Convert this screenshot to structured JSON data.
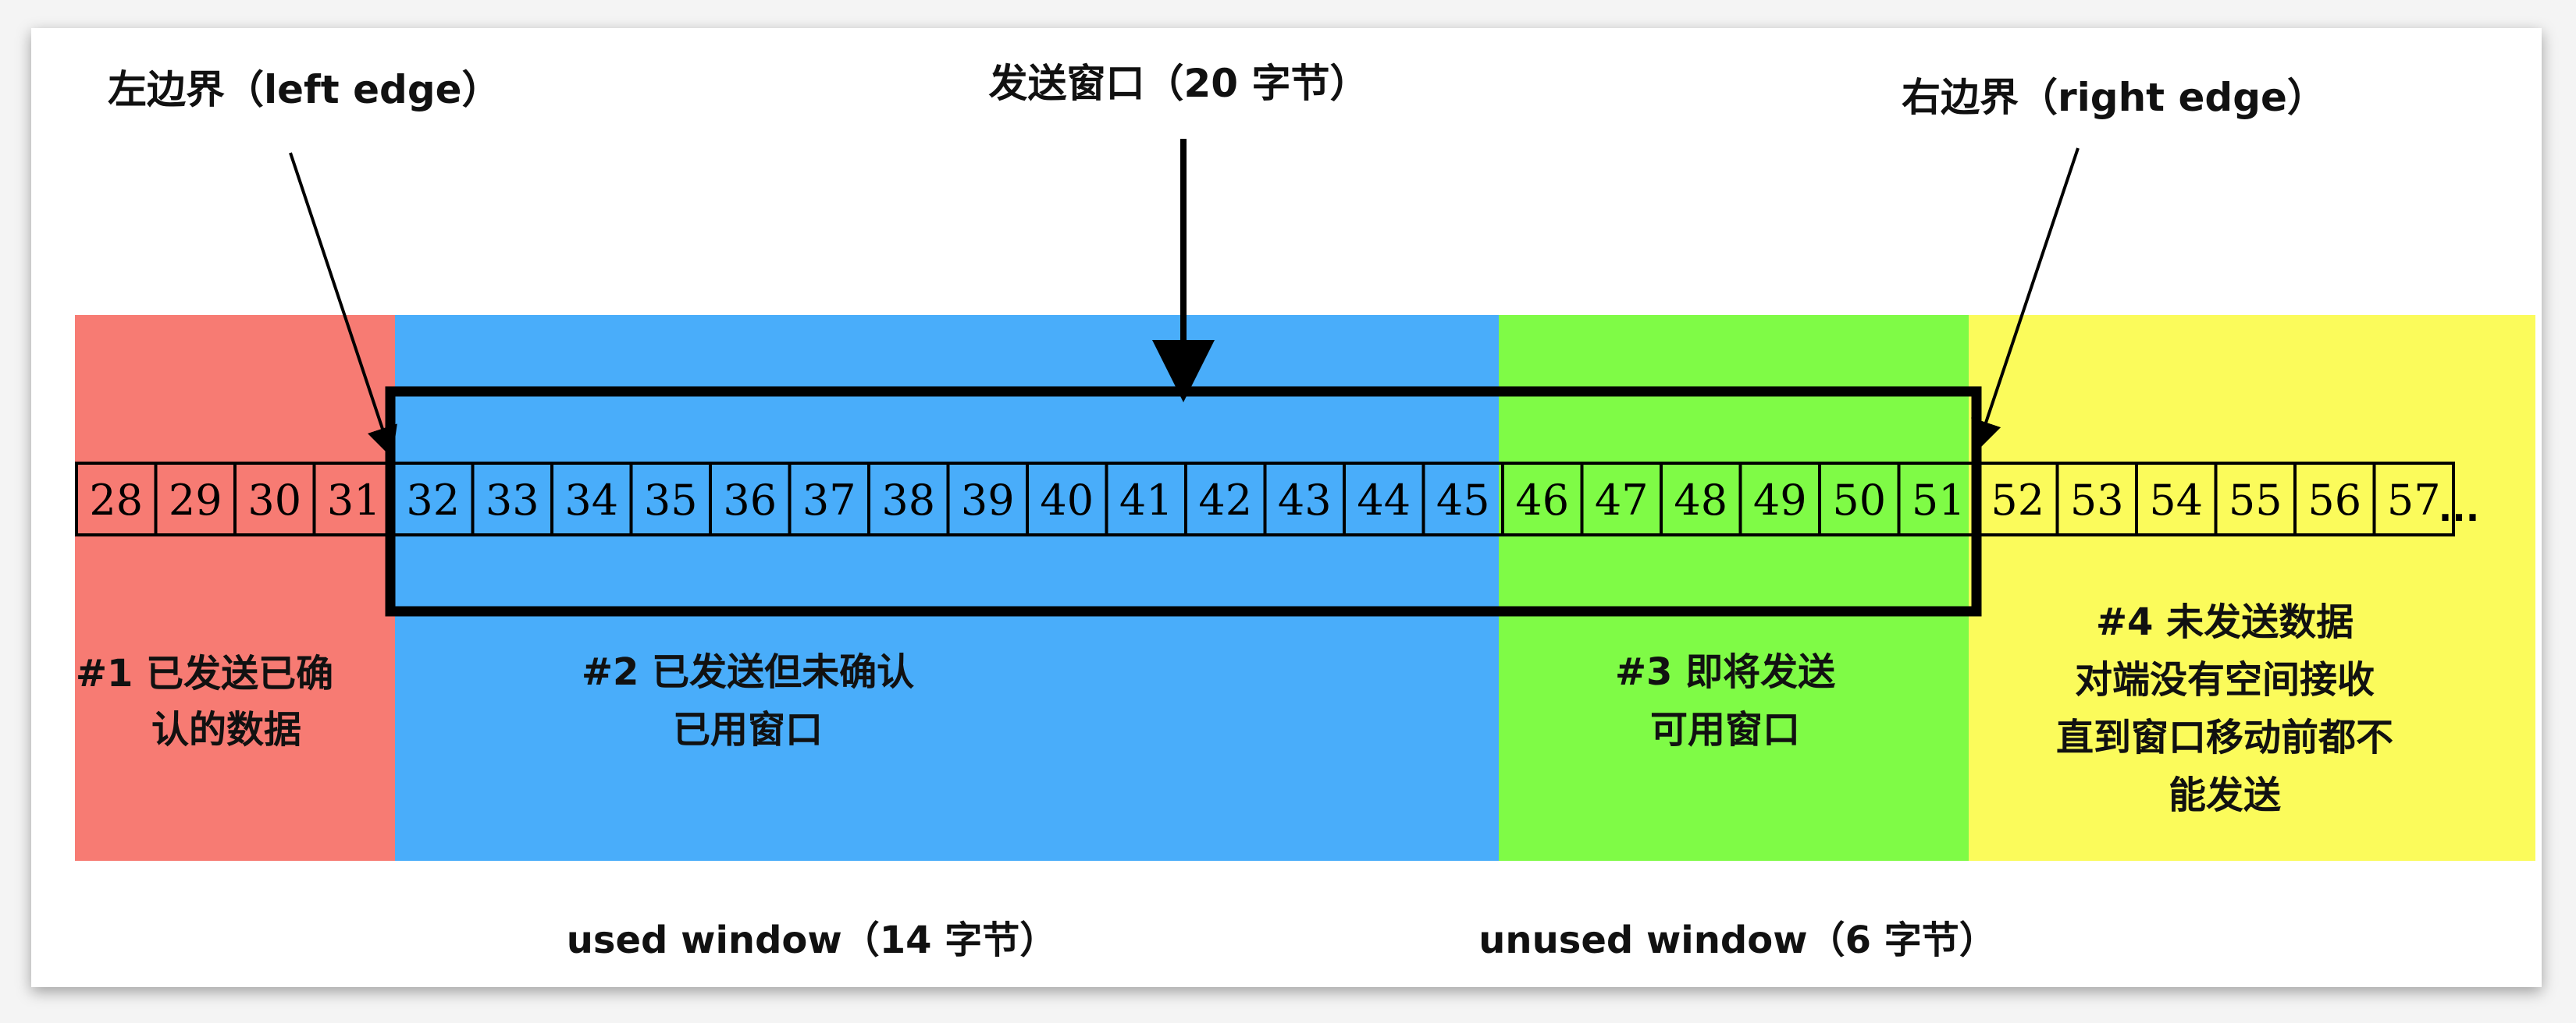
{
  "colors": {
    "region1": "#f77b73",
    "region2": "#49adfa",
    "region3": "#7ffb46",
    "region4": "#fbfb5b",
    "ink": "#000000"
  },
  "cells": [
    "28",
    "29",
    "30",
    "31",
    "32",
    "33",
    "34",
    "35",
    "36",
    "37",
    "38",
    "39",
    "40",
    "41",
    "42",
    "43",
    "44",
    "45",
    "46",
    "47",
    "48",
    "49",
    "50",
    "51",
    "52",
    "53",
    "54",
    "55",
    "56",
    "57"
  ],
  "ellipsis": "...",
  "top_labels": {
    "left_edge": "左边界（left edge）",
    "send_window": "发送窗口（20 字节）",
    "right_edge": "右边界（right edge）"
  },
  "regions": {
    "r1": {
      "line1": "#1 已发送已确",
      "line2": "认的数据"
    },
    "r2": {
      "line1": "#2 已发送但未确认",
      "line2": "已用窗口"
    },
    "r3": {
      "line1": "#3 即将发送",
      "line2": "可用窗口"
    },
    "r4": {
      "line1": "#4 未发送数据",
      "line2": "对端没有空间接收",
      "line3": "直到窗口移动前都不",
      "line4": "能发送"
    }
  },
  "bottom_labels": {
    "used_window": "used window（14 字节）",
    "unused_window": "unused window（6 字节）"
  }
}
